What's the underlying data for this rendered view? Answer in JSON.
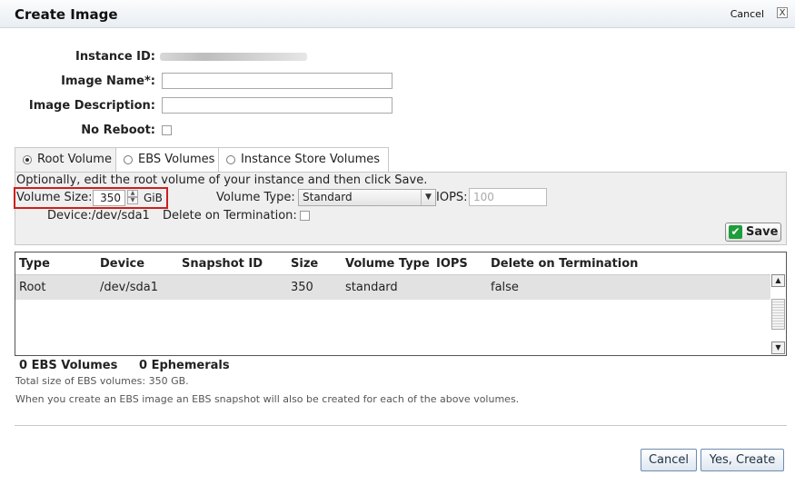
{
  "dialog": {
    "title": "Create Image",
    "cancel_link": "Cancel",
    "close_symbol": "X"
  },
  "form": {
    "instance_id_label": "Instance ID:",
    "image_name_label": "Image Name*:",
    "image_description_label": "Image Description:",
    "no_reboot_label": "No Reboot:"
  },
  "tabs": [
    {
      "label": "Root Volume",
      "selected": true
    },
    {
      "label": "EBS Volumes",
      "selected": false
    },
    {
      "label": "Instance Store Volumes",
      "selected": false
    }
  ],
  "root_volume": {
    "hint": "Optionally, edit the root volume of your instance and then click Save.",
    "volume_size_label": "Volume Size:",
    "volume_size_value": "350",
    "volume_size_unit": "GiB",
    "volume_type_label": "Volume Type:",
    "volume_type_value": "Standard",
    "iops_label": "IOPS:",
    "iops_placeholder": "100",
    "device_label": "Device:/dev/sda1",
    "delete_on_termination_label": "Delete on Termination:",
    "save_label": "Save"
  },
  "table": {
    "headers": [
      "Type",
      "Device",
      "Snapshot ID",
      "Size",
      "Volume Type",
      "IOPS",
      "Delete on Termination"
    ],
    "rows": [
      [
        "Root",
        "/dev/sda1",
        "",
        "350",
        "standard",
        "",
        "false"
      ]
    ]
  },
  "summary": {
    "ebs_volumes": "0 EBS Volumes",
    "ephemerals": "0 Ephemerals",
    "total_size": "Total size of EBS volumes: 350 GB.",
    "note": "When you create an EBS image an EBS snapshot will also be created for each of the above volumes."
  },
  "footer": {
    "cancel_label": "Cancel",
    "create_label": "Yes, Create"
  },
  "colors": {
    "highlight_border": "#cc1f1f",
    "save_check": "#1f9d3a"
  }
}
